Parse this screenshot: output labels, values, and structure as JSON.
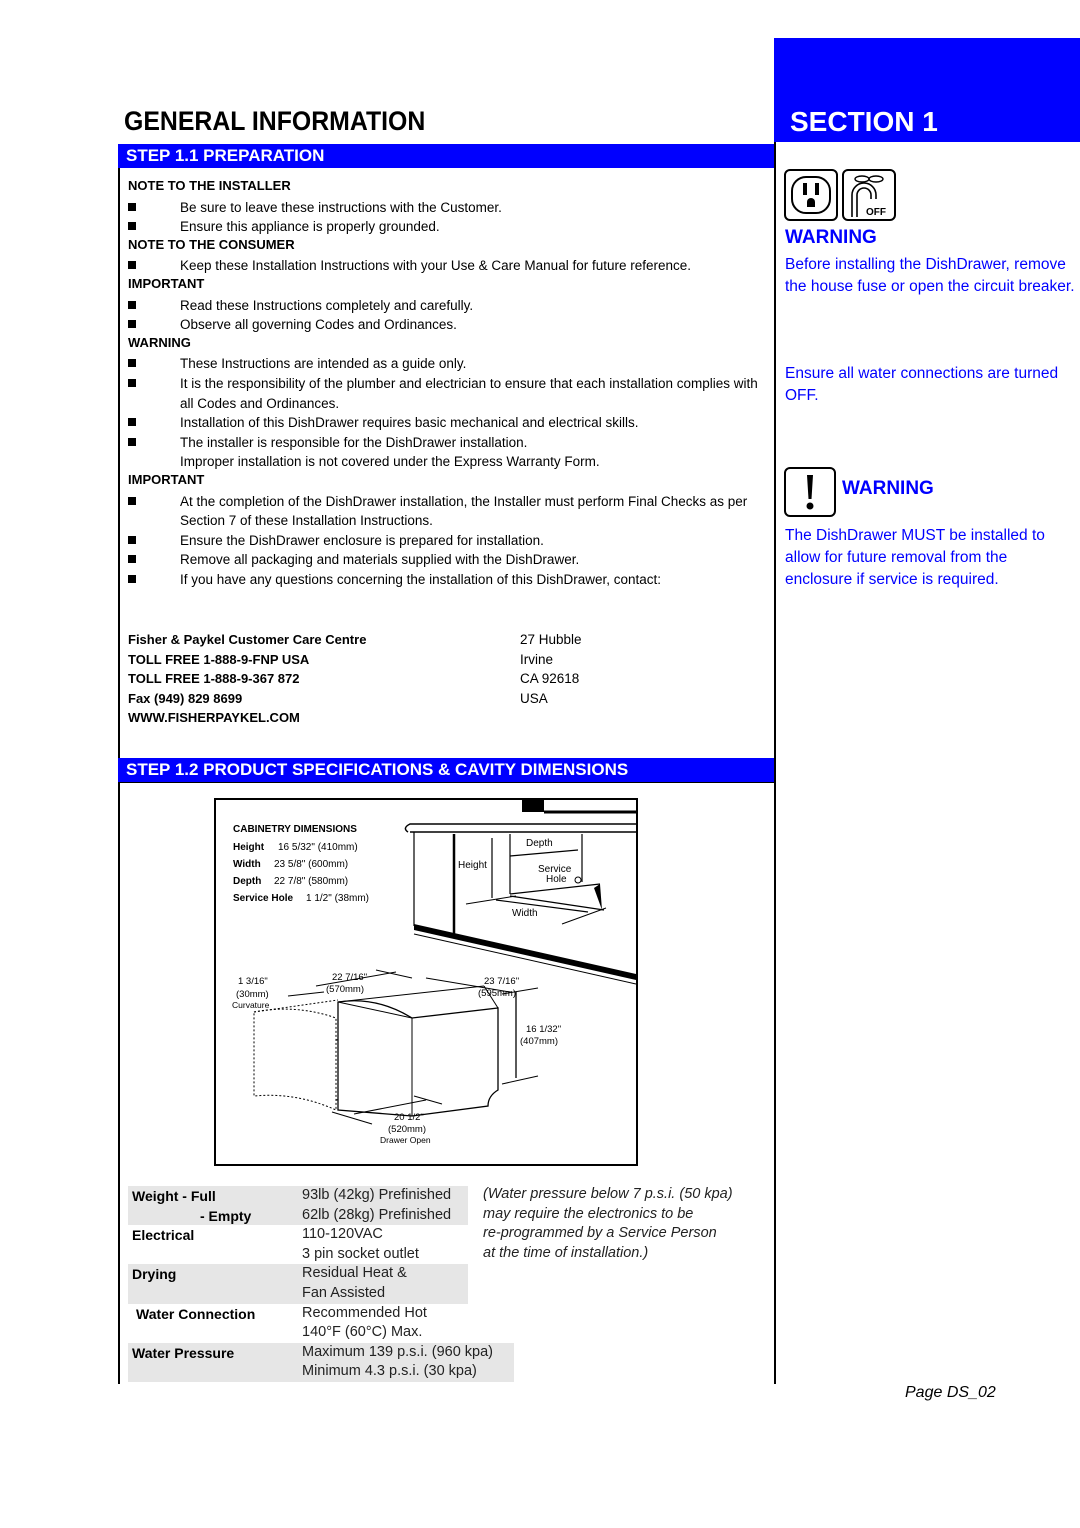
{
  "header": {
    "title": "GENERAL  INFORMATION",
    "section": "SECTION  1"
  },
  "step11": {
    "title": "STEP  1.1  PREPARATION",
    "groups": [
      {
        "heading": "NOTE TO THE INSTALLER",
        "items": [
          "Be sure to leave these instructions with the Customer.",
          "Ensure this appliance is properly grounded."
        ]
      },
      {
        "heading": "NOTE TO THE CONSUMER",
        "items": [
          "Keep these Installation Instructions with your Use & Care Manual for future reference."
        ]
      },
      {
        "heading": "IMPORTANT",
        "items": [
          "Read these Instructions completely and carefully.",
          "Observe all governing Codes and Ordinances."
        ]
      },
      {
        "heading": "WARNING",
        "items": [
          "These Instructions are intended as a guide only.",
          "It is the responsibility of the plumber and electrician to ensure that each installation complies with all Codes and Ordinances.",
          "Installation of this DishDrawer requires basic mechanical and electrical skills.",
          "The installer is responsible for the DishDrawer installation.",
          "Improper installation is not covered under the Express Warranty Form."
        ]
      },
      {
        "heading": "IMPORTANT",
        "items": [
          "At the completion of the DishDrawer installation, the Installer must perform Final Checks as per Section 7 of these Installation Instructions.",
          "Ensure the DishDrawer enclosure is prepared for installation.",
          "Remove all packaging and materials supplied with the DishDrawer.",
          "If you have any questions concerning the installation of this DishDrawer, contact:"
        ]
      }
    ],
    "contact": {
      "lines": [
        "Fisher & Paykel Customer Care Centre",
        "TOLL FREE 1-888-9-FNP USA",
        "TOLL FREE 1-888-9-367 872",
        "Fax (949) 829 8699",
        "WWW.FISHERPAYKEL.COM"
      ],
      "address": [
        "27 Hubble",
        "Irvine",
        "CA 92618",
        "USA"
      ]
    }
  },
  "sidebar": {
    "warning1": {
      "icons": [
        "power-outlet-icon",
        "water-tap-off-icon"
      ],
      "tap_label": "OFF",
      "heading": "WARNING",
      "text1": "Before installing the DishDrawer, remove the house fuse or open the circuit breaker.",
      "text2": "Ensure all water connections are turned OFF."
    },
    "warning2": {
      "icon": "exclamation-icon",
      "heading": "WARNING",
      "text": "The DishDrawer MUST be installed to allow for future removal from the enclosure if service is required."
    }
  },
  "step12": {
    "title": "STEP  1.2  PRODUCT SPECIFICATIONS & CAVITY DIMENSIONS",
    "diagram": {
      "cabinetry_title": "CABINETRY DIMENSIONS",
      "cabinetry": [
        {
          "label": "Height",
          "value": "16 5/32\" (410mm)"
        },
        {
          "label": "Width",
          "value": "23 5/8\" (600mm)"
        },
        {
          "label": "Depth",
          "value": "22 7/8\" (580mm)"
        },
        {
          "label": "Service Hole",
          "value": "1 1/2\" (38mm)"
        }
      ],
      "cavity_labels": {
        "depth": "Depth",
        "height": "Height",
        "service": "Service",
        "hole": "Hole",
        "width": "Width"
      },
      "product": {
        "curvature": [
          "1 3/16\"",
          "(30mm)",
          "Curvature"
        ],
        "depth": [
          "22 7/16\"",
          "(570mm)"
        ],
        "width": [
          "23 7/16\"",
          "(595mm)"
        ],
        "height": [
          "16 1/32\"",
          "(407mm)"
        ],
        "open": [
          "20 1/2\"",
          "(520mm)",
          "Drawer Open"
        ]
      }
    },
    "specs": [
      {
        "label": "Weight  - Full",
        "values": [
          "93lb (42kg) Prefinished"
        ],
        "shade": true
      },
      {
        "label": "- Empty",
        "values": [
          "62lb (28kg) Prefinished"
        ],
        "shade": true
      },
      {
        "label": "Electrical",
        "values": [
          "110-120VAC",
          "3 pin socket outlet"
        ],
        "shade": false
      },
      {
        "label": "Drying",
        "values": [
          "Residual Heat &",
          "Fan Assisted"
        ],
        "shade": true
      },
      {
        "label": "Water Connection",
        "values": [
          "Recommended Hot",
          "140°F (60°C) Max."
        ],
        "shade": false
      },
      {
        "label": "Water Pressure",
        "values": [
          "Maximum 139 p.s.i. (960 kpa)",
          "Minimum 4.3 p.s.i. (30 kpa)"
        ],
        "shade": true
      }
    ],
    "note": [
      "(Water pressure below 7 p.s.i. (50 kpa)",
      "may require the electronics to be",
      "re-programmed by a Service Person",
      "at the time of installation.)"
    ]
  },
  "footer": {
    "page": "Page DS_02"
  }
}
